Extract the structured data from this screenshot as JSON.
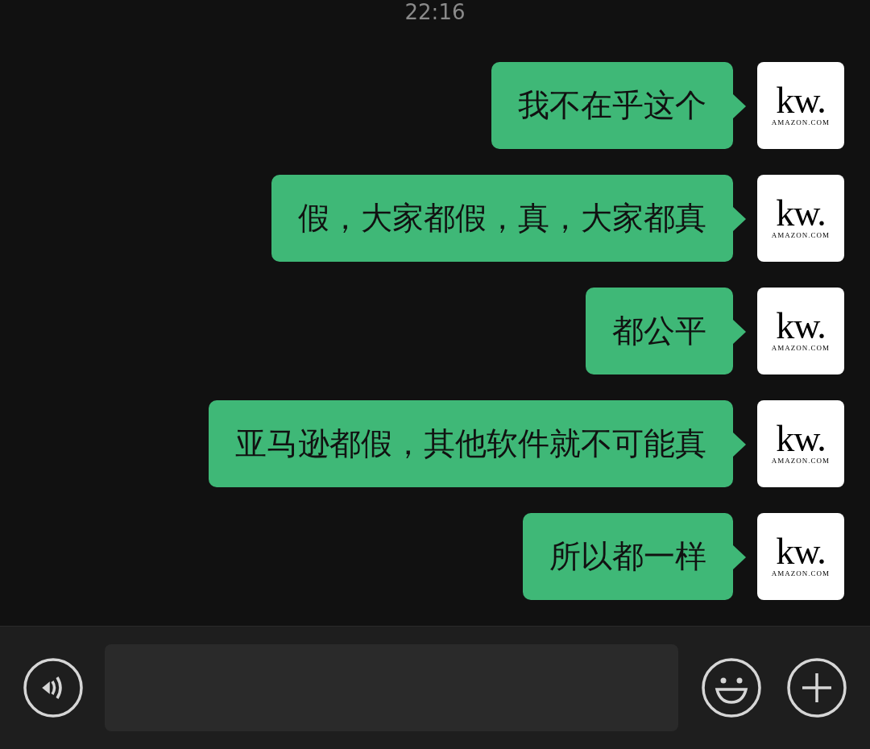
{
  "timestamp": "22:16",
  "messages": [
    {
      "text": "我不在乎这个",
      "avatar": {
        "title": "kw.",
        "subtitle": "AMAZON.COM"
      }
    },
    {
      "text": "假，大家都假，真，大家都真",
      "avatar": {
        "title": "kw.",
        "subtitle": "AMAZON.COM"
      }
    },
    {
      "text": "都公平",
      "avatar": {
        "title": "kw.",
        "subtitle": "AMAZON.COM"
      }
    },
    {
      "text": "亚马逊都假，其他软件就不可能真",
      "avatar": {
        "title": "kw.",
        "subtitle": "AMAZON.COM"
      }
    },
    {
      "text": "所以都一样",
      "avatar": {
        "title": "kw.",
        "subtitle": "AMAZON.COM"
      }
    }
  ]
}
